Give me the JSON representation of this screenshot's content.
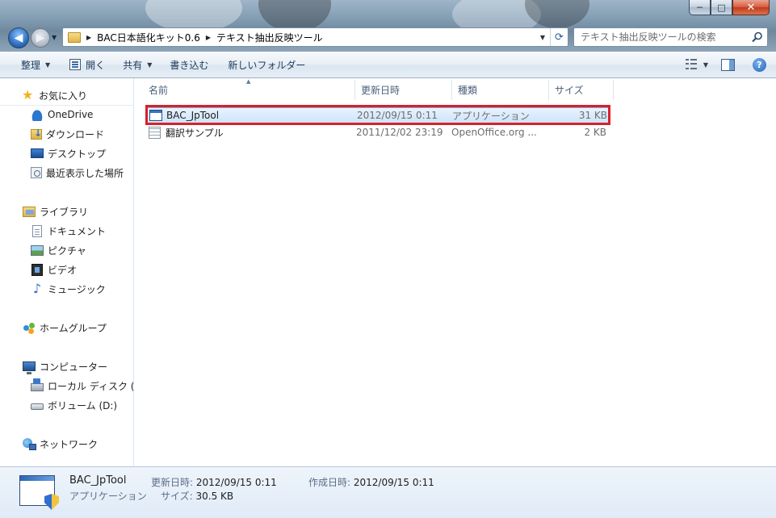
{
  "window": {
    "minimize_glyph": "─",
    "maximize_glyph": "□",
    "close_glyph": "✕"
  },
  "nav": {
    "back_glyph": "◀",
    "forward_glyph": "▶"
  },
  "address": {
    "segments": [
      "BAC日本語化キット0.6",
      "テキスト抽出反映ツール"
    ]
  },
  "search": {
    "placeholder": "テキスト抽出反映ツールの検索"
  },
  "toolbar": {
    "organize": "整理",
    "open": "開く",
    "share": "共有",
    "burn": "書き込む",
    "new_folder": "新しいフォルダー",
    "help_glyph": "?"
  },
  "sidebar": {
    "favorites": {
      "label": "お気に入り",
      "items": [
        "OneDrive",
        "ダウンロード",
        "デスクトップ",
        "最近表示した場所"
      ]
    },
    "libraries": {
      "label": "ライブラリ",
      "items": [
        "ドキュメント",
        "ピクチャ",
        "ビデオ",
        "ミュージック"
      ]
    },
    "homegroup": {
      "label": "ホームグループ"
    },
    "computer": {
      "label": "コンピューター",
      "items": [
        "ローカル ディスク (",
        "ボリューム (D:)"
      ]
    },
    "network": {
      "label": "ネットワーク"
    }
  },
  "columns": {
    "name": "名前",
    "date": "更新日時",
    "type": "種類",
    "size": "サイズ"
  },
  "files": [
    {
      "name": "BAC_JpTool",
      "date": "2012/09/15 0:11",
      "type": "アプリケーション",
      "size": "31 KB",
      "icon": "application-icon",
      "selected": true
    },
    {
      "name": "翻訳サンプル",
      "date": "2011/12/02 23:19",
      "type": "OpenOffice.org ...",
      "size": "2 KB",
      "icon": "spreadsheet-icon",
      "selected": false
    }
  ],
  "details": {
    "name": "BAC_JpTool",
    "type": "アプリケーション",
    "modified_label": "更新日時:",
    "modified_value": "2012/09/15 0:11",
    "created_label": "作成日時:",
    "created_value": "2012/09/15 0:11",
    "size_label": "サイズ:",
    "size_value": "30.5 KB"
  },
  "colors": {
    "selection_highlight": "#d8202a",
    "accent": "#1e3a5c"
  }
}
